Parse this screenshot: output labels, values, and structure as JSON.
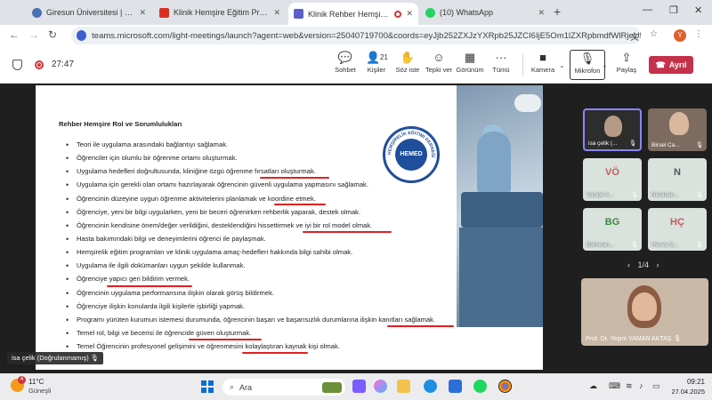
{
  "browser": {
    "tabs": [
      {
        "title": "Giresun Üniversitesi | Kuzeyin Hi",
        "favicon_color": "#4a6fb5"
      },
      {
        "title": "Klinik Hemşire Eğitim Programı",
        "favicon_color": "#d93025"
      },
      {
        "title": "Klinik Rehber Hemşire Eğiti",
        "favicon_color": "#5b5fc7"
      },
      {
        "title": "(10) WhatsApp",
        "favicon_color": "#25d366"
      }
    ],
    "url": "teams.microsoft.com/light-meetings/launch?agent=web&version=25040719700&coords=eyJjb252ZXJzYXRpb25JZCI6IjE5Om1lZXRpbmdfWlRjeU56TTJNe...",
    "profile_initial": "Y"
  },
  "meeting": {
    "timer": "27:47",
    "tools": [
      {
        "label": "Sohbet",
        "icon": "chat-icon",
        "glyph": "💬"
      },
      {
        "label": "Kişiler",
        "icon": "people-icon",
        "glyph": "👤",
        "count": "21"
      },
      {
        "label": "Söz iste",
        "icon": "raise-hand-icon",
        "glyph": "✋"
      },
      {
        "label": "Tepki ver",
        "icon": "emoji-icon",
        "glyph": "☺"
      },
      {
        "label": "Görünüm",
        "icon": "view-icon",
        "glyph": "▦"
      },
      {
        "label": "Tümü",
        "icon": "more-icon",
        "glyph": "···"
      }
    ],
    "camera_label": "Kamera",
    "mic_label": "Mikrofon",
    "share_label": "Paylaş",
    "leave_label": "Ayrıl"
  },
  "slide": {
    "title": "Rehber Hemşire Rol ve Sorumlulukları",
    "logo_text": "HEMED",
    "logo_ring_text": "HEMŞİRELİK EĞİTİMİ DERNEĞİ",
    "bullets": [
      "Teori ile uygulama arasındaki bağlantıyı sağlamak.",
      "Öğrenciler için olumlu bir öğrenme ortamı oluşturmak.",
      "Uygulama hedefleri doğrultusunda, kliniğine özgü öğrenme fırsatları oluşturmak.",
      "Uygulama için gerekli olan ortamı hazırlayarak öğrencinin güvenli uygulama yapmasını sağlamak.",
      "Öğrencinin düzeyine uygun öğrenme aktivitelerini planlamak ve koordine etmek.",
      "Öğrenciye, yeni bir bilgi uygularken, yeni bir beceri öğrenirken rehberlik yaparak, destek olmak.",
      "Öğrencinin kendisine önem/değer verildiğini, desteklendiğini hissettirmek ve iyi bir rol model olmak.",
      "Hasta bakımındaki bilgi ve deneyimlerini öğrenci ile paylaşmak.",
      "Hemşirelik eğitim programları ve klinik uygulama amaç-hedefleri hakkında bilgi sahibi olmak.",
      "Uygulama ile ilgili dokümanları uygun şekilde kullanmak.",
      "Öğrenciye yapıcı geri bildirim vermek.",
      "Öğrencinin uygulama performansına ilişkin olarak görüş bildirmek.",
      "Öğrenciye ilişkin konularda ilgili kişilerle işbirliği yapmak.",
      "Programı yürüten kurumun istemesi durumunda, öğrencinin başarı ve başarısızlık durumlarına ilişkin kanıtları sağlamak.",
      "Temel rol, bilgi ve becerisi ile öğrencide güven oluşturmak.",
      "Temel Öğrencinin profesyonel gelişimini ve öğrenmesini kolaylaştıran kaynak kişi olmak."
    ],
    "self_name": "isa çelik (Doğrulanmamış)"
  },
  "participants": {
    "tiles": [
      {
        "name": "isa çelik (...",
        "initials": "",
        "kind": "video-dark",
        "active": true
      },
      {
        "name": "Birsel Ca...",
        "initials": "",
        "kind": "video-dark",
        "active": false
      },
      {
        "name": "Vacide A...",
        "initials": "VÖ",
        "kind": "avatar",
        "color": "#c55a5a"
      },
      {
        "name": "Neslihan...",
        "initials": "N",
        "kind": "avatar",
        "color": "#555555"
      },
      {
        "name": "Bahrican...",
        "initials": "BG",
        "kind": "avatar",
        "color": "#3b8a3b"
      },
      {
        "name": "Havva Ç...",
        "initials": "HÇ",
        "kind": "avatar",
        "color": "#c55a5a"
      }
    ],
    "pager": "1/4",
    "speaker_name": "Prof. Dr. Yeşim YAMAN AKTAŞ"
  },
  "taskbar": {
    "weather_temp": "11°C",
    "weather_city": "Güneşli",
    "weather_badge": "4",
    "search_placeholder": "Ara",
    "time": "09:21",
    "date": "27.04.2025"
  }
}
